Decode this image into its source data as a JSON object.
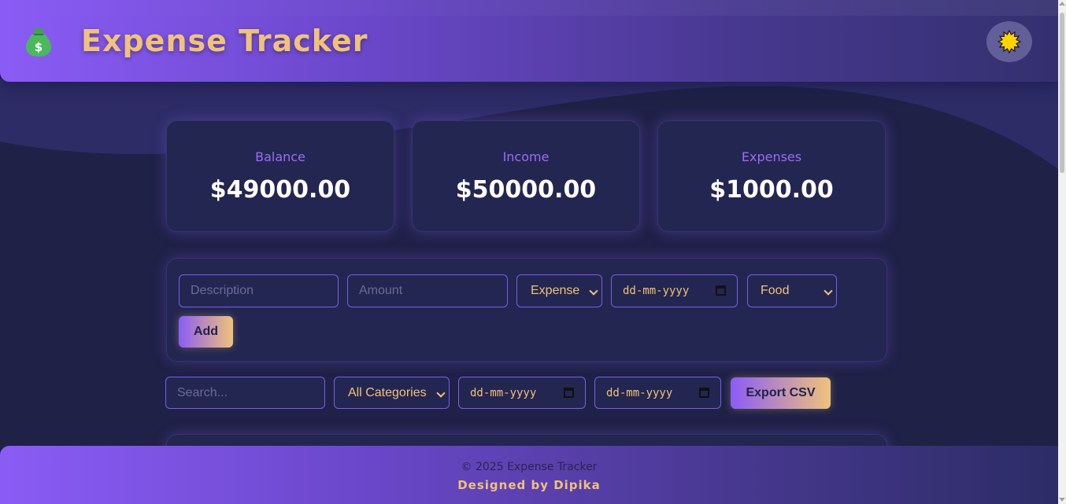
{
  "header": {
    "title": "Expense Tracker",
    "logo_icon": "money-bag-icon",
    "theme_toggle_icon": "sun-icon"
  },
  "summary": {
    "balance": {
      "label": "Balance",
      "value": "$49000.00"
    },
    "income": {
      "label": "Income",
      "value": "$50000.00"
    },
    "expenses": {
      "label": "Expenses",
      "value": "$1000.00"
    }
  },
  "form": {
    "description_placeholder": "Description",
    "amount_placeholder": "Amount",
    "type_value": "Expense",
    "date_placeholder": "dd-mm-yyyy",
    "category_value": "Food",
    "add_label": "Add"
  },
  "filters": {
    "search_placeholder": "Search...",
    "category_value": "All Categories",
    "from_date_placeholder": "dd-mm-yyyy",
    "to_date_placeholder": "dd-mm-yyyy",
    "export_label": "Export CSV"
  },
  "footer": {
    "copyright": "© 2025 Expense Tracker",
    "credit": "Designed by Dipika"
  },
  "colors": {
    "accent_purple": "#8b5cf6",
    "accent_gold": "#f0c27a",
    "background": "#1f2147",
    "card": "#232650"
  }
}
